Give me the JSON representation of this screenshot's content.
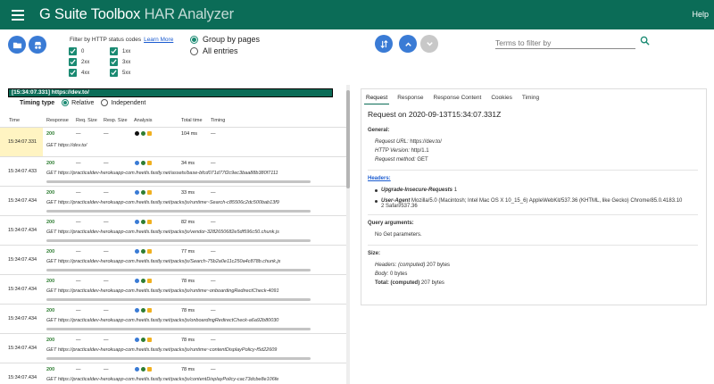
{
  "app": {
    "title_main": "G Suite Toolbox",
    "title_sub": "HAR Analyzer",
    "help": "Help"
  },
  "toolbar": {
    "filter_label": "Filter by HTTP status codes",
    "learn_more": "Learn More",
    "status_filters": [
      "0",
      "1xx",
      "2xx",
      "3xx",
      "4xx",
      "5xx"
    ],
    "group_by_pages": "Group by pages",
    "all_entries": "All entries",
    "search_placeholder": "Terms to filter by"
  },
  "page": {
    "url_header": "[15:34:07.331] https://dev.to/",
    "timing_type_label": "Timing type",
    "timing_relative": "Relative",
    "timing_independent": "Independent"
  },
  "columns": [
    "Time",
    "Response",
    "Req. Size",
    "Resp. Size",
    "Analysis",
    "Total time",
    "Timing"
  ],
  "rows": [
    {
      "time": "15:34:07.331",
      "status": "200",
      "req": "—",
      "resp": "—",
      "total": "104 ms",
      "timing": "—",
      "url": "GET https://dev.to/"
    },
    {
      "time": "15:34:07.433",
      "status": "200",
      "req": "—",
      "resp": "—",
      "total": "34 ms",
      "timing": "—",
      "url": "GET https://practicaldev-herokuapp-com.freetls.fastly.net/assets/base-bfcd071d77f2c9ec3baa88b380f7111"
    },
    {
      "time": "15:34:07.434",
      "status": "200",
      "req": "—",
      "resp": "—",
      "total": "33 ms",
      "timing": "—",
      "url": "GET https://practicaldev-herokuapp-com.freetls.fastly.net/packs/js/runtime~Search-c85506c2dc500bab13f9"
    },
    {
      "time": "15:34:07.434",
      "status": "200",
      "req": "—",
      "resp": "—",
      "total": "82 ms",
      "timing": "—",
      "url": "GET https://practicaldev-herokuapp-com.freetls.fastly.net/packs/js/vendor-3282650682e5df596c50.chunk.js"
    },
    {
      "time": "15:34:07.434",
      "status": "200",
      "req": "—",
      "resp": "—",
      "total": "77 ms",
      "timing": "—",
      "url": "GET https://practicaldev-herokuapp-com.freetls.fastly.net/packs/js/Search-75b2a0e11c250a4c878b.chunk.js"
    },
    {
      "time": "15:34:07.434",
      "status": "200",
      "req": "—",
      "resp": "—",
      "total": "78 ms",
      "timing": "—",
      "url": "GET https://practicaldev-herokuapp-com.freetls.fastly.net/packs/js/runtime~onboardingRedirectCheck-4091"
    },
    {
      "time": "15:34:07.434",
      "status": "200",
      "req": "—",
      "resp": "—",
      "total": "78 ms",
      "timing": "—",
      "url": "GET https://practicaldev-herokuapp-com.freetls.fastly.net/packs/js/onboardingRedirectCheck-a6a92b80030"
    },
    {
      "time": "15:34:07.434",
      "status": "200",
      "req": "—",
      "resp": "—",
      "total": "78 ms",
      "timing": "—",
      "url": "GET https://practicaldev-herokuapp-com.freetls.fastly.net/packs/js/runtime~contentDisplayPolicy-f5d22609"
    },
    {
      "time": "15:34:07.434",
      "status": "200",
      "req": "—",
      "resp": "—",
      "total": "78 ms",
      "timing": "—",
      "url": "GET https://practicaldev-herokuapp-com.freetls.fastly.net/packs/js/contentDisplayPolicy-cac73dcbe8e106fe"
    }
  ],
  "detail": {
    "tabs": [
      "Request",
      "Response",
      "Response Content",
      "Cookies",
      "Timing"
    ],
    "title": "Request on 2020-09-13T15:34:07.331Z",
    "general_heading": "General:",
    "request_url_key": "Request URL:",
    "request_url_val": "https://dev.to/",
    "http_version_key": "HTTP Version:",
    "http_version_val": "http/1.1",
    "request_method_key": "Request method:",
    "request_method_val": "GET",
    "headers_heading": "Headers:",
    "header1_key": "Upgrade-Insecure-Requests",
    "header1_val": "1",
    "header2_key": "User-Agent",
    "header2_val": "Mozilla/5.0 (Macintosh; Intel Mac OS X 10_15_6) AppleWebKit/537.36 (KHTML, like Gecko) Chrome/85.0.4183.10",
    "header2_val_cont": "2 Safari/537.36",
    "query_heading": "Query arguments:",
    "query_none": "No Get parameters.",
    "size_heading": "Size:",
    "headers_size_key": "Headers: (computed)",
    "headers_size_val": "207 bytes",
    "body_key": "Body:",
    "body_val": "0 bytes",
    "total_key": "Total: (computed)",
    "total_val": "207 bytes"
  },
  "colors": {
    "appbar": "#0b6c57",
    "accent": "#1a8a72",
    "button": "#3a7bd5",
    "status_ok": "#2e7d32"
  }
}
